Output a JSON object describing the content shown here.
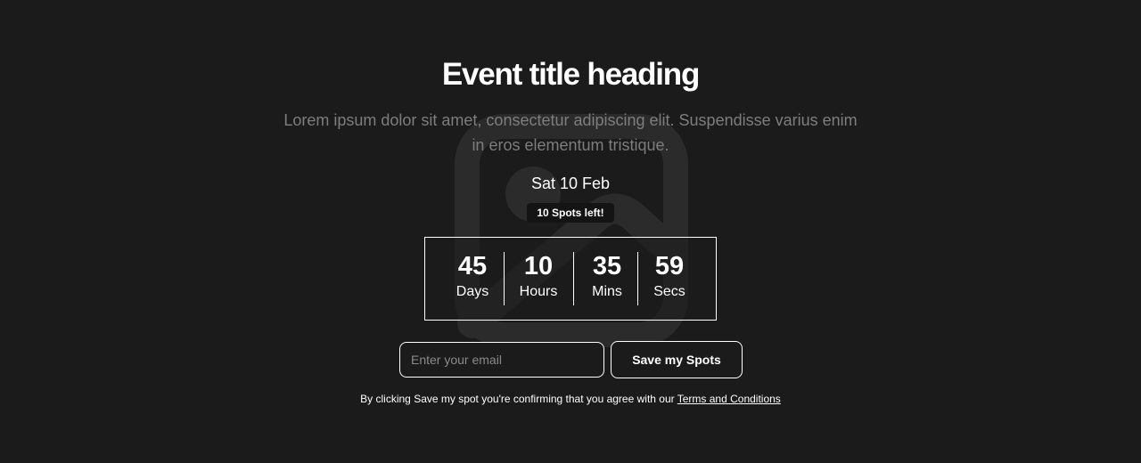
{
  "event": {
    "title": "Event title heading",
    "description": "Lorem ipsum dolor sit amet, consectetur adipiscing elit. Suspendisse varius enim in eros elementum tristique.",
    "date": "Sat 10 Feb",
    "spots_left": "10 Spots left!"
  },
  "countdown": {
    "units": [
      {
        "value": "45",
        "label": "Days"
      },
      {
        "value": "10",
        "label": "Hours"
      },
      {
        "value": "35",
        "label": "Mins"
      },
      {
        "value": "59",
        "label": "Secs"
      }
    ]
  },
  "signup": {
    "email_placeholder": "Enter your email",
    "email_value": "",
    "button_label": "Save my Spots",
    "disclaimer_text": "By clicking Save my spot you're confirming that you agree with our ",
    "terms_link": "Terms and Conditions"
  },
  "background": {
    "icon": "image-placeholder-icon"
  },
  "colors": {
    "background": "#1b1b1b",
    "text": "#ffffff",
    "muted_text": "#7d7d7d",
    "badge": "#141414",
    "watermark": "#2b2b2b"
  }
}
